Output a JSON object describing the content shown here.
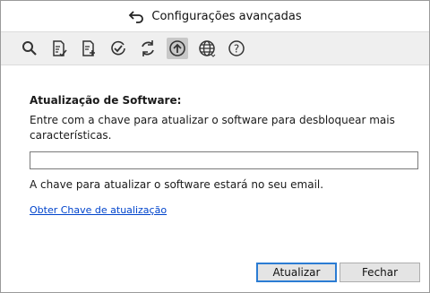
{
  "window": {
    "title": "Configurações avançadas"
  },
  "toolbar": {
    "icons": [
      "search-icon",
      "document-edit-icon",
      "document-add-icon",
      "check-circle-icon",
      "refresh-icon",
      "upload-icon",
      "globe-icon",
      "help-icon"
    ],
    "active": "upload-icon"
  },
  "section": {
    "heading": "Atualização de Software:",
    "description": "Entre com a chave para atualizar o software para desbloquear mais características.",
    "input_value": "",
    "note": "A chave para atualizar o software estará no seu email.",
    "link": "Obter Chave de atualização"
  },
  "buttons": {
    "update": "Atualizar",
    "close": "Fechar"
  }
}
